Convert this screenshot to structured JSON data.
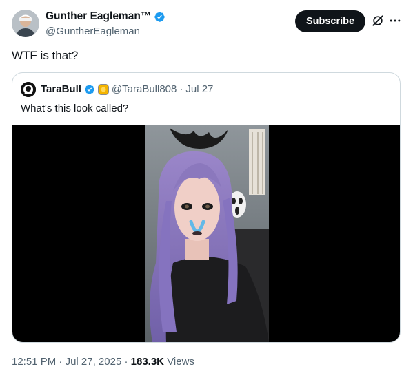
{
  "author": {
    "name": "Gunther Eagleman™",
    "handle": "@GuntherEagleman"
  },
  "actions": {
    "subscribe_label": "Subscribe"
  },
  "icons": {
    "verified": "verified-badge-icon",
    "grok": "grok-icon",
    "more": "more-options-icon"
  },
  "tweet": {
    "text": "WTF is that?"
  },
  "quoted": {
    "name": "TaraBull",
    "handle": "@TaraBull808",
    "separator": "·",
    "date": "Jul 27",
    "text": "What's this look called?"
  },
  "footer": {
    "time": "12:51 PM",
    "date": "Jul 27, 2025",
    "separator": "·",
    "views_count": "183.3K",
    "views_label": "Views"
  },
  "colors": {
    "verified_blue": "#1d9bf0",
    "subscribe_bg": "#0f1419",
    "secondary_text": "#536471",
    "card_border": "#cfd9de"
  }
}
